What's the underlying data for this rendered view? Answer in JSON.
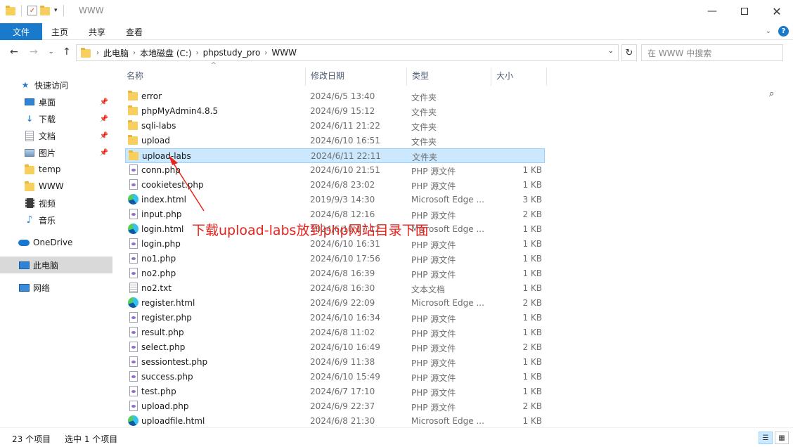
{
  "window": {
    "title": "WWW",
    "controls": [
      "minimize-icon",
      "maximize-icon",
      "close-icon"
    ]
  },
  "ribbon": {
    "tabs": [
      {
        "label": "文件",
        "active": true
      },
      {
        "label": "主页"
      },
      {
        "label": "共享"
      },
      {
        "label": "查看"
      }
    ]
  },
  "address": {
    "crumbs": [
      "此电脑",
      "本地磁盘 (C:)",
      "phpstudy_pro",
      "WWW"
    ],
    "search_placeholder": "在 WWW 中搜索"
  },
  "nav": {
    "items": [
      {
        "label": "快速访问",
        "icon": "star-icon",
        "pinned": false
      },
      {
        "label": "桌面",
        "icon": "desktop-icon",
        "pinned": true
      },
      {
        "label": "下载",
        "icon": "download-icon",
        "pinned": true
      },
      {
        "label": "文档",
        "icon": "document-icon",
        "pinned": true
      },
      {
        "label": "图片",
        "icon": "picture-icon",
        "pinned": true
      },
      {
        "label": "temp",
        "icon": "folder-icon",
        "pinned": false
      },
      {
        "label": "WWW",
        "icon": "folder-icon",
        "pinned": false
      },
      {
        "label": "视频",
        "icon": "video-icon",
        "pinned": false
      },
      {
        "label": "音乐",
        "icon": "music-icon",
        "pinned": false
      },
      {
        "label": "OneDrive",
        "icon": "cloud-icon",
        "pinned": false
      },
      {
        "label": "此电脑",
        "icon": "computer-icon",
        "pinned": false,
        "selected": true
      },
      {
        "label": "网络",
        "icon": "network-icon",
        "pinned": false
      }
    ]
  },
  "columns": {
    "name": "名称",
    "date": "修改日期",
    "type": "类型",
    "size": "大小"
  },
  "files": [
    {
      "name": "error",
      "date": "2024/6/5 13:40",
      "type": "文件夹",
      "size": "",
      "icon": "folder"
    },
    {
      "name": "phpMyAdmin4.8.5",
      "date": "2024/6/9 15:12",
      "type": "文件夹",
      "size": "",
      "icon": "folder"
    },
    {
      "name": "sqli-labs",
      "date": "2024/6/11 21:22",
      "type": "文件夹",
      "size": "",
      "icon": "folder"
    },
    {
      "name": "upload",
      "date": "2024/6/10 16:51",
      "type": "文件夹",
      "size": "",
      "icon": "folder"
    },
    {
      "name": "upload-labs",
      "date": "2024/6/11 22:11",
      "type": "文件夹",
      "size": "",
      "icon": "folder",
      "selected": true
    },
    {
      "name": "conn.php",
      "date": "2024/6/10 21:51",
      "type": "PHP 源文件",
      "size": "1 KB",
      "icon": "php"
    },
    {
      "name": "cookietest.php",
      "date": "2024/6/8 23:02",
      "type": "PHP 源文件",
      "size": "1 KB",
      "icon": "php"
    },
    {
      "name": "index.html",
      "date": "2019/9/3 14:30",
      "type": "Microsoft Edge ...",
      "size": "3 KB",
      "icon": "edge"
    },
    {
      "name": "input.php",
      "date": "2024/6/8 12:16",
      "type": "PHP 源文件",
      "size": "2 KB",
      "icon": "php"
    },
    {
      "name": "login.html",
      "date": "2024/6/10 17:12",
      "type": "Microsoft Edge ...",
      "size": "1 KB",
      "icon": "edge"
    },
    {
      "name": "login.php",
      "date": "2024/6/10 16:31",
      "type": "PHP 源文件",
      "size": "1 KB",
      "icon": "php"
    },
    {
      "name": "no1.php",
      "date": "2024/6/10 17:56",
      "type": "PHP 源文件",
      "size": "1 KB",
      "icon": "php"
    },
    {
      "name": "no2.php",
      "date": "2024/6/8 16:39",
      "type": "PHP 源文件",
      "size": "1 KB",
      "icon": "php"
    },
    {
      "name": "no2.txt",
      "date": "2024/6/8 16:30",
      "type": "文本文档",
      "size": "1 KB",
      "icon": "txt"
    },
    {
      "name": "register.html",
      "date": "2024/6/9 22:09",
      "type": "Microsoft Edge ...",
      "size": "2 KB",
      "icon": "edge"
    },
    {
      "name": "register.php",
      "date": "2024/6/10 16:34",
      "type": "PHP 源文件",
      "size": "1 KB",
      "icon": "php"
    },
    {
      "name": "result.php",
      "date": "2024/6/8 11:02",
      "type": "PHP 源文件",
      "size": "1 KB",
      "icon": "php"
    },
    {
      "name": "select.php",
      "date": "2024/6/10 16:49",
      "type": "PHP 源文件",
      "size": "2 KB",
      "icon": "php"
    },
    {
      "name": "sessiontest.php",
      "date": "2024/6/9 11:38",
      "type": "PHP 源文件",
      "size": "1 KB",
      "icon": "php"
    },
    {
      "name": "success.php",
      "date": "2024/6/10 15:49",
      "type": "PHP 源文件",
      "size": "1 KB",
      "icon": "php"
    },
    {
      "name": "test.php",
      "date": "2024/6/7 17:10",
      "type": "PHP 源文件",
      "size": "1 KB",
      "icon": "php"
    },
    {
      "name": "upload.php",
      "date": "2024/6/9 22:37",
      "type": "PHP 源文件",
      "size": "2 KB",
      "icon": "php"
    },
    {
      "name": "uploadfile.html",
      "date": "2024/6/8 21:30",
      "type": "Microsoft Edge ...",
      "size": "1 KB",
      "icon": "edge"
    }
  ],
  "status": {
    "count": "23 个项目",
    "selection": "选中 1 个项目"
  },
  "annotation": {
    "text": "下载upload-labs放到php网站目录下面",
    "color": "#e8231c"
  },
  "colors": {
    "accent": "#1979ca",
    "selection": "#cce8ff"
  }
}
